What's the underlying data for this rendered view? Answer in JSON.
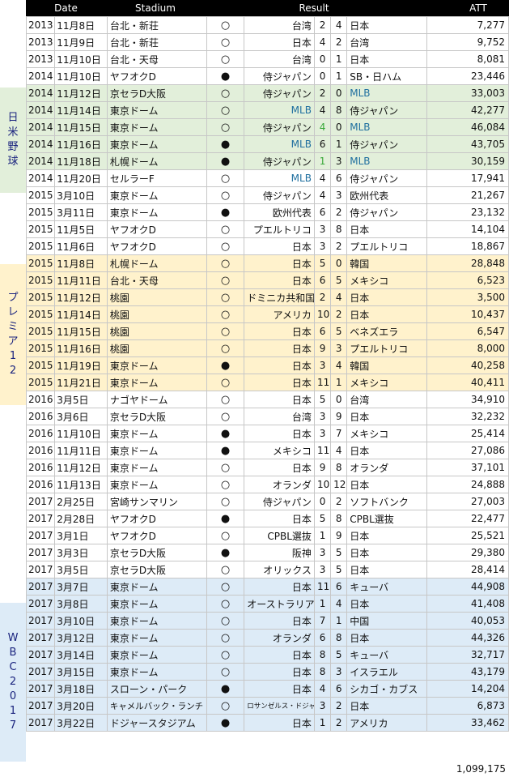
{
  "header": {
    "date": "Date",
    "stadium": "Stadium",
    "result": "Result",
    "att": "ATT"
  },
  "groups": [
    {
      "chars": [
        "日",
        "米",
        "野",
        "球"
      ]
    },
    {
      "chars": [
        "プ",
        "レ",
        "ミ",
        "ア",
        "1",
        "2"
      ]
    },
    {
      "chars": [
        "W",
        "B",
        "C",
        "2",
        "0",
        "1",
        "7"
      ]
    }
  ],
  "colors": {
    "group1": "#e2efda",
    "group2": "#fff2cc",
    "group3": "#ddebf7",
    "mlb_text": "#1f6f9f",
    "green_score": "#38a839"
  },
  "rows": [
    {
      "year": "2013",
      "date": "11月8日",
      "stadium": "台北・新荘",
      "mark": "○",
      "home": "台湾",
      "hs": "2",
      "as": "4",
      "away": "日本",
      "att": "7,277"
    },
    {
      "year": "2013",
      "date": "11月9日",
      "stadium": "台北・新荘",
      "mark": "○",
      "home": "日本",
      "hs": "4",
      "as": "2",
      "away": "台湾",
      "att": "9,752"
    },
    {
      "year": "2013",
      "date": "11月10日",
      "stadium": "台北・天母",
      "mark": "○",
      "home": "台湾",
      "hs": "0",
      "as": "1",
      "away": "日本",
      "att": "8,081"
    },
    {
      "year": "2014",
      "date": "11月10日",
      "stadium": "ヤフオクD",
      "mark": "●",
      "home": "侍ジャパン",
      "hs": "0",
      "as": "1",
      "away": "SB・日ハム",
      "att": "23,446"
    },
    {
      "year": "2014",
      "date": "11月12日",
      "stadium": "京セラD大阪",
      "mark": "○",
      "home": "侍ジャパン",
      "hs": "2",
      "as": "0",
      "away": "MLB",
      "att": "33,003"
    },
    {
      "year": "2014",
      "date": "11月14日",
      "stadium": "東京ドーム",
      "mark": "○",
      "home": "MLB",
      "hs": "4",
      "as": "8",
      "away": "侍ジャパン",
      "att": "42,277"
    },
    {
      "year": "2014",
      "date": "11月15日",
      "stadium": "東京ドーム",
      "mark": "○",
      "home": "侍ジャパン",
      "hs": "4",
      "as": "0",
      "away": "MLB",
      "att": "46,084"
    },
    {
      "year": "2014",
      "date": "11月16日",
      "stadium": "東京ドーム",
      "mark": "●",
      "home": "MLB",
      "hs": "6",
      "as": "1",
      "away": "侍ジャパン",
      "att": "43,705"
    },
    {
      "year": "2014",
      "date": "11月18日",
      "stadium": "札幌ドーム",
      "mark": "●",
      "home": "侍ジャパン",
      "hs": "1",
      "as": "3",
      "away": "MLB",
      "att": "30,159"
    },
    {
      "year": "2014",
      "date": "11月20日",
      "stadium": "セルラーF",
      "mark": "○",
      "home": "MLB",
      "hs": "4",
      "as": "6",
      "away": "侍ジャパン",
      "att": "17,941"
    },
    {
      "year": "2015",
      "date": "3月10日",
      "stadium": "東京ドーム",
      "mark": "○",
      "home": "侍ジャパン",
      "hs": "4",
      "as": "3",
      "away": "欧州代表",
      "att": "21,267"
    },
    {
      "year": "2015",
      "date": "3月11日",
      "stadium": "東京ドーム",
      "mark": "●",
      "home": "欧州代表",
      "hs": "6",
      "as": "2",
      "away": "侍ジャパン",
      "att": "23,132"
    },
    {
      "year": "2015",
      "date": "11月5日",
      "stadium": "ヤフオクD",
      "mark": "○",
      "home": "プエルトリコ",
      "hs": "3",
      "as": "8",
      "away": "日本",
      "att": "14,104"
    },
    {
      "year": "2015",
      "date": "11月6日",
      "stadium": "ヤフオクD",
      "mark": "○",
      "home": "日本",
      "hs": "3",
      "as": "2",
      "away": "プエルトリコ",
      "att": "18,867"
    },
    {
      "year": "2015",
      "date": "11月8日",
      "stadium": "札幌ドーム",
      "mark": "○",
      "home": "日本",
      "hs": "5",
      "as": "0",
      "away": "韓国",
      "att": "28,848"
    },
    {
      "year": "2015",
      "date": "11月11日",
      "stadium": "台北・天母",
      "mark": "○",
      "home": "日本",
      "hs": "6",
      "as": "5",
      "away": "メキシコ",
      "att": "6,523"
    },
    {
      "year": "2015",
      "date": "11月12日",
      "stadium": "桃園",
      "mark": "○",
      "home": "ドミニカ共和国",
      "hs": "2",
      "as": "4",
      "away": "日本",
      "att": "3,500"
    },
    {
      "year": "2015",
      "date": "11月14日",
      "stadium": "桃園",
      "mark": "○",
      "home": "アメリカ",
      "hs": "10",
      "as": "2",
      "away": "日本",
      "att": "10,437"
    },
    {
      "year": "2015",
      "date": "11月15日",
      "stadium": "桃園",
      "mark": "○",
      "home": "日本",
      "hs": "6",
      "as": "5",
      "away": "ベネズエラ",
      "att": "6,547"
    },
    {
      "year": "2015",
      "date": "11月16日",
      "stadium": "桃園",
      "mark": "○",
      "home": "日本",
      "hs": "9",
      "as": "3",
      "away": "プエルトリコ",
      "att": "8,000"
    },
    {
      "year": "2015",
      "date": "11月19日",
      "stadium": "東京ドーム",
      "mark": "●",
      "home": "日本",
      "hs": "3",
      "as": "4",
      "away": "韓国",
      "att": "40,258"
    },
    {
      "year": "2015",
      "date": "11月21日",
      "stadium": "東京ドーム",
      "mark": "○",
      "home": "日本",
      "hs": "11",
      "as": "1",
      "away": "メキシコ",
      "att": "40,411"
    },
    {
      "year": "2016",
      "date": "3月5日",
      "stadium": "ナゴヤドーム",
      "mark": "○",
      "home": "日本",
      "hs": "5",
      "as": "0",
      "away": "台湾",
      "att": "34,910"
    },
    {
      "year": "2016",
      "date": "3月6日",
      "stadium": "京セラD大阪",
      "mark": "○",
      "home": "台湾",
      "hs": "3",
      "as": "9",
      "away": "日本",
      "att": "32,232"
    },
    {
      "year": "2016",
      "date": "11月10日",
      "stadium": "東京ドーム",
      "mark": "●",
      "home": "日本",
      "hs": "3",
      "as": "7",
      "away": "メキシコ",
      "att": "25,414"
    },
    {
      "year": "2016",
      "date": "11月11日",
      "stadium": "東京ドーム",
      "mark": "●",
      "home": "メキシコ",
      "hs": "11",
      "as": "4",
      "away": "日本",
      "att": "27,086"
    },
    {
      "year": "2016",
      "date": "11月12日",
      "stadium": "東京ドーム",
      "mark": "○",
      "home": "日本",
      "hs": "9",
      "as": "8",
      "away": "オランダ",
      "att": "37,101"
    },
    {
      "year": "2016",
      "date": "11月13日",
      "stadium": "東京ドーム",
      "mark": "○",
      "home": "オランダ",
      "hs": "10",
      "as": "12",
      "away": "日本",
      "att": "24,888"
    },
    {
      "year": "2017",
      "date": "2月25日",
      "stadium": "宮崎サンマリン",
      "mark": "○",
      "home": "侍ジャパン",
      "hs": "0",
      "as": "2",
      "away": "ソフトバンク",
      "att": "27,003"
    },
    {
      "year": "2017",
      "date": "2月28日",
      "stadium": "ヤフオクD",
      "mark": "●",
      "home": "日本",
      "hs": "5",
      "as": "8",
      "away": "CPBL選抜",
      "att": "22,477"
    },
    {
      "year": "2017",
      "date": "3月1日",
      "stadium": "ヤフオクD",
      "mark": "○",
      "home": "CPBL選抜",
      "hs": "1",
      "as": "9",
      "away": "日本",
      "att": "25,521"
    },
    {
      "year": "2017",
      "date": "3月3日",
      "stadium": "京セラD大阪",
      "mark": "●",
      "home": "阪神",
      "hs": "3",
      "as": "5",
      "away": "日本",
      "att": "29,380"
    },
    {
      "year": "2017",
      "date": "3月5日",
      "stadium": "京セラD大阪",
      "mark": "○",
      "home": "オリックス",
      "hs": "3",
      "as": "5",
      "away": "日本",
      "att": "28,414"
    },
    {
      "year": "2017",
      "date": "3月7日",
      "stadium": "東京ドーム",
      "mark": "○",
      "home": "日本",
      "hs": "11",
      "as": "6",
      "away": "キューバ",
      "att": "44,908"
    },
    {
      "year": "2017",
      "date": "3月8日",
      "stadium": "東京ドーム",
      "mark": "○",
      "home": "オーストラリア",
      "hs": "1",
      "as": "4",
      "away": "日本",
      "att": "41,408"
    },
    {
      "year": "2017",
      "date": "3月10日",
      "stadium": "東京ドーム",
      "mark": "○",
      "home": "日本",
      "hs": "7",
      "as": "1",
      "away": "中国",
      "att": "40,053"
    },
    {
      "year": "2017",
      "date": "3月12日",
      "stadium": "東京ドーム",
      "mark": "○",
      "home": "オランダ",
      "hs": "6",
      "as": "8",
      "away": "日本",
      "att": "44,326"
    },
    {
      "year": "2017",
      "date": "3月14日",
      "stadium": "東京ドーム",
      "mark": "○",
      "home": "日本",
      "hs": "8",
      "as": "5",
      "away": "キューバ",
      "att": "32,717"
    },
    {
      "year": "2017",
      "date": "3月15日",
      "stadium": "東京ドーム",
      "mark": "○",
      "home": "日本",
      "hs": "8",
      "as": "3",
      "away": "イスラエル",
      "att": "43,179"
    },
    {
      "year": "2017",
      "date": "3月18日",
      "stadium": "スローン・パーク",
      "mark": "●",
      "home": "日本",
      "hs": "4",
      "as": "6",
      "away": "シカゴ・カブス",
      "att": "14,204"
    },
    {
      "year": "2017",
      "date": "3月20日",
      "stadium": "キャメルバック・ランチ",
      "mark": "○",
      "home": "ロサンゼルス・ドジャース",
      "hs": "3",
      "as": "2",
      "away": "日本",
      "att": "6,873"
    },
    {
      "year": "2017",
      "date": "3月22日",
      "stadium": "ドジャースタジアム",
      "mark": "●",
      "home": "日本",
      "hs": "1",
      "as": "2",
      "away": "アメリカ",
      "att": "33,462"
    }
  ],
  "total": "1,099,175"
}
